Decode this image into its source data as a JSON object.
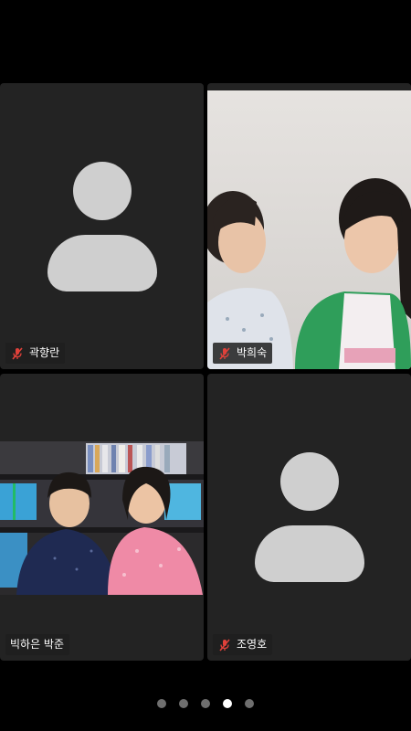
{
  "participants": [
    {
      "name": "곽향란",
      "muted": true,
      "video_on": false,
      "avatar_icon": "person-placeholder-icon"
    },
    {
      "name": "박희숙",
      "muted": true,
      "video_on": true
    },
    {
      "name": "빅하은 박준",
      "muted": false,
      "video_on": true
    },
    {
      "name": "조영호",
      "muted": true,
      "video_on": false,
      "avatar_icon": "person-placeholder-icon"
    }
  ],
  "pager": {
    "page_count": 5,
    "active_page": 4
  },
  "colors": {
    "background": "#000000",
    "tile": "#232323",
    "avatar": "#cfcfcf",
    "mute_icon": "#e0413a",
    "dot_inactive": "#6f6f6f",
    "dot_active": "#ffffff"
  }
}
